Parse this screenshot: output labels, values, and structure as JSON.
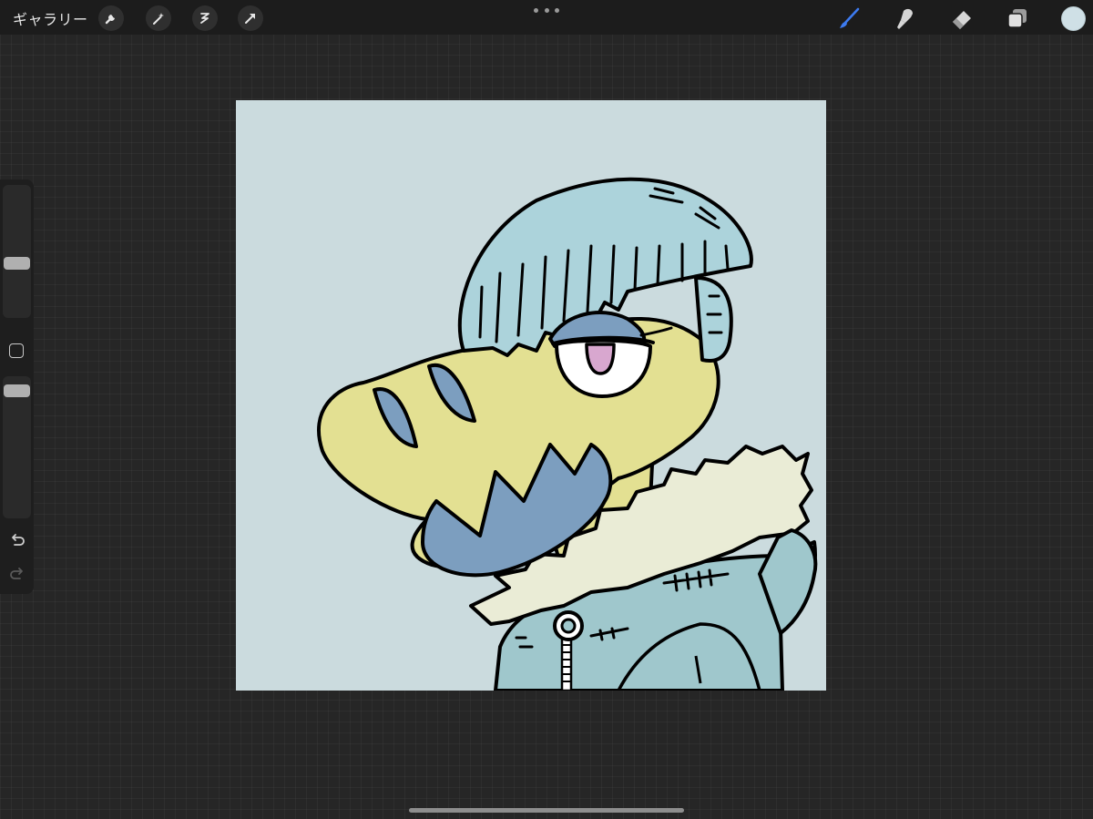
{
  "toolbar": {
    "gallery_label": "ギャラリー",
    "left_tools": [
      "wrench-icon",
      "magic-wand-icon",
      "selection-icon",
      "transform-arrow-icon"
    ],
    "right_tools": [
      "brush-icon",
      "smudge-icon",
      "eraser-icon",
      "layers-icon"
    ],
    "active_tool": "brush",
    "accent_color": "#3d7bf0",
    "current_color": "#cfe0e6"
  },
  "sidebar": {
    "brush_size_level": 0.31,
    "opacity_level": 0.79,
    "icons": [
      "modifier-square-icon",
      "undo-icon",
      "redo-icon"
    ]
  },
  "canvas": {
    "background_color": "#cbdbde",
    "palette": [
      "#e3e092",
      "#7c9ebf",
      "#acd3db",
      "#9fc7cc",
      "#eaecd6",
      "#d8a7cf",
      "#000000"
    ]
  }
}
